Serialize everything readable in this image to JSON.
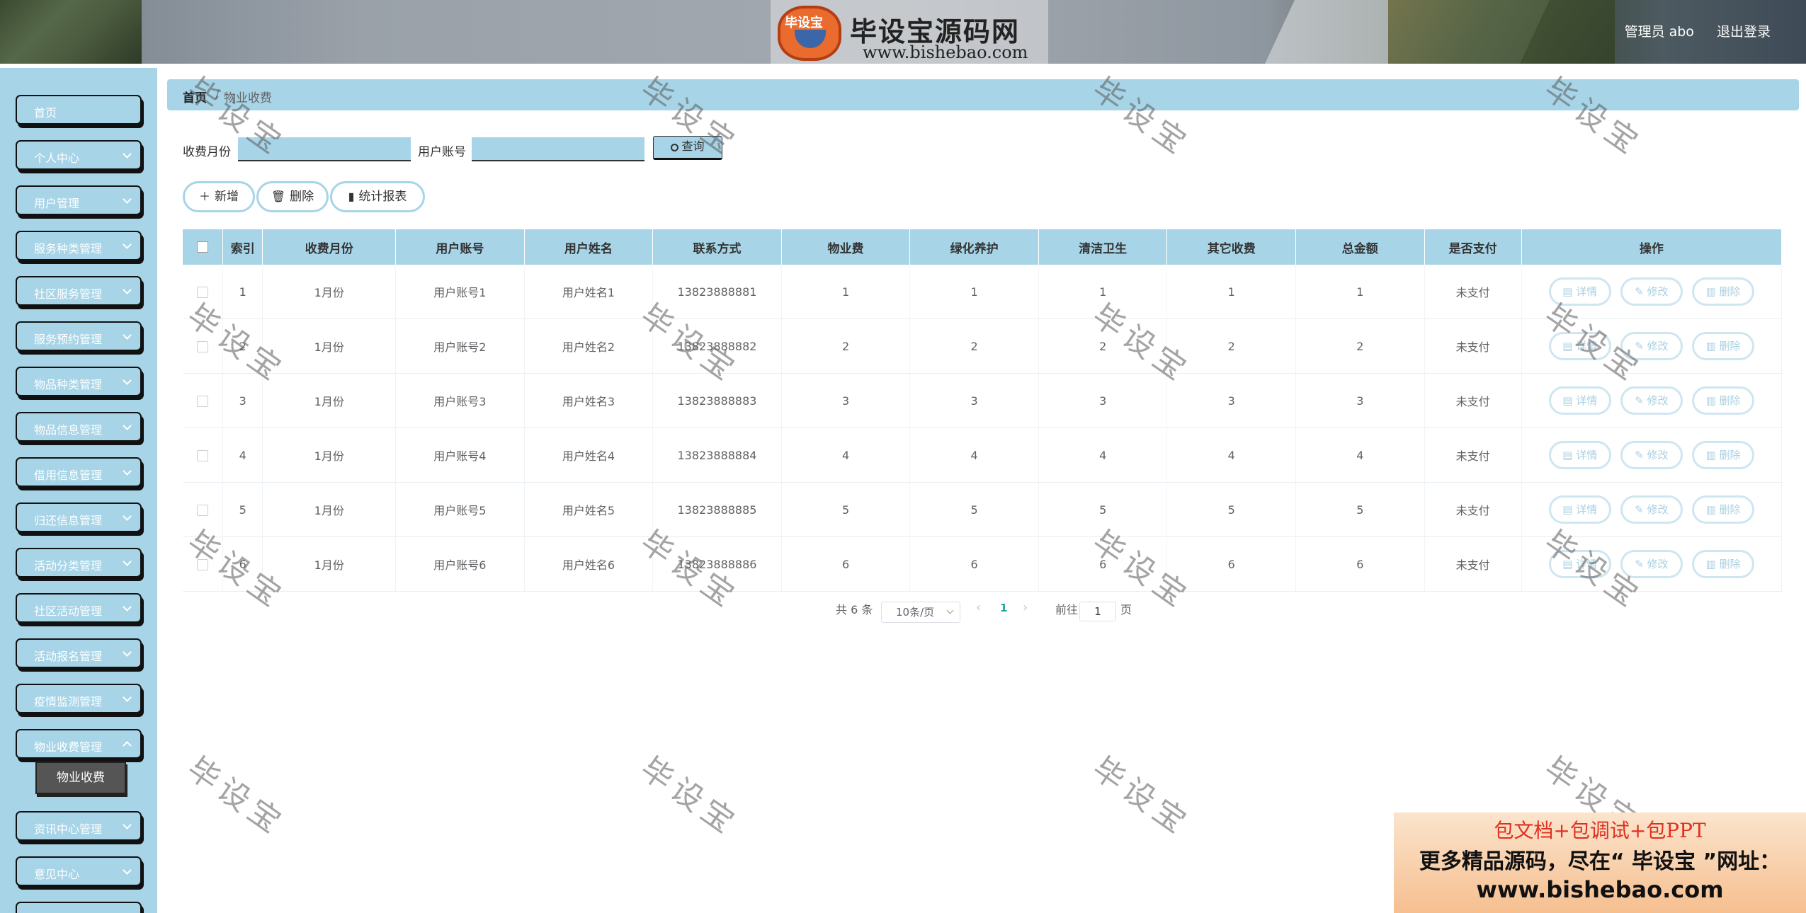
{
  "header": {
    "logo_mark": "毕设宝",
    "logo_title": "毕设宝源码网",
    "logo_url": "www.bishebao.com",
    "user_label": "管理员 abo",
    "logout_label": "退出登录"
  },
  "sidebar": {
    "items": [
      {
        "label": "首页",
        "has_chevron": false
      },
      {
        "label": "个人中心",
        "has_chevron": true
      },
      {
        "label": "用户管理",
        "has_chevron": true
      },
      {
        "label": "服务种类管理",
        "has_chevron": true
      },
      {
        "label": "社区服务管理",
        "has_chevron": true
      },
      {
        "label": "服务预约管理",
        "has_chevron": true
      },
      {
        "label": "物品种类管理",
        "has_chevron": true
      },
      {
        "label": "物品信息管理",
        "has_chevron": true
      },
      {
        "label": "借用信息管理",
        "has_chevron": true
      },
      {
        "label": "归还信息管理",
        "has_chevron": true
      },
      {
        "label": "活动分类管理",
        "has_chevron": true
      },
      {
        "label": "社区活动管理",
        "has_chevron": true
      },
      {
        "label": "活动报名管理",
        "has_chevron": true
      },
      {
        "label": "疫情监测管理",
        "has_chevron": true
      },
      {
        "label": "物业收费管理",
        "has_chevron": true
      },
      {
        "label": "资讯中心管理",
        "has_chevron": true
      },
      {
        "label": "意见中心",
        "has_chevron": true
      }
    ],
    "active_submenu": "物业收费"
  },
  "breadcrumb": {
    "home": "首页",
    "separator": "/",
    "current": "物业收费"
  },
  "search": {
    "month_label": "收费月份",
    "month_placeholder": "",
    "account_label": "用户账号",
    "account_placeholder": "",
    "query_label": "查询"
  },
  "actions": {
    "add_label": "新增",
    "delete_label": "删除",
    "report_label": "统计报表"
  },
  "table": {
    "columns": [
      "索引",
      "收费月份",
      "用户账号",
      "用户姓名",
      "联系方式",
      "物业费",
      "绿化养护",
      "清洁卫生",
      "其它收费",
      "总金额",
      "是否支付",
      "操作"
    ],
    "row_actions": {
      "detail": "详情",
      "edit": "修改",
      "delete": "删除"
    },
    "rows": [
      {
        "index": "1",
        "month": "1月份",
        "account": "用户账号1",
        "name": "用户姓名1",
        "phone": "13823888881",
        "property_fee": "1",
        "greening": "1",
        "cleaning": "1",
        "other": "1",
        "total": "1",
        "paid": "未支付"
      },
      {
        "index": "2",
        "month": "1月份",
        "account": "用户账号2",
        "name": "用户姓名2",
        "phone": "13823888882",
        "property_fee": "2",
        "greening": "2",
        "cleaning": "2",
        "other": "2",
        "total": "2",
        "paid": "未支付"
      },
      {
        "index": "3",
        "month": "1月份",
        "account": "用户账号3",
        "name": "用户姓名3",
        "phone": "13823888883",
        "property_fee": "3",
        "greening": "3",
        "cleaning": "3",
        "other": "3",
        "total": "3",
        "paid": "未支付"
      },
      {
        "index": "4",
        "month": "1月份",
        "account": "用户账号4",
        "name": "用户姓名4",
        "phone": "13823888884",
        "property_fee": "4",
        "greening": "4",
        "cleaning": "4",
        "other": "4",
        "total": "4",
        "paid": "未支付"
      },
      {
        "index": "5",
        "month": "1月份",
        "account": "用户账号5",
        "name": "用户姓名5",
        "phone": "13823888885",
        "property_fee": "5",
        "greening": "5",
        "cleaning": "5",
        "other": "5",
        "total": "5",
        "paid": "未支付"
      },
      {
        "index": "6",
        "month": "1月份",
        "account": "用户账号6",
        "name": "用户姓名6",
        "phone": "13823888886",
        "property_fee": "6",
        "greening": "6",
        "cleaning": "6",
        "other": "6",
        "total": "6",
        "paid": "未支付"
      }
    ]
  },
  "pagination": {
    "total_text": "共 6 条",
    "page_size": "10条/页",
    "current_page": "1",
    "goto_label": "前往",
    "goto_value": "1",
    "page_unit": "页"
  },
  "watermark": "毕设宝",
  "promo": {
    "line1": "包文档+包调试+包PPT",
    "line2": "更多精品源码，尽在“ 毕设宝 ”网址：",
    "line3": "www.bishebao.com"
  },
  "colors": {
    "accent": "#a7d4e7",
    "submenu_active": "#555555",
    "page_active": "#1aa89b",
    "promo_red": "#e03020"
  },
  "icons": {
    "search": "search-icon",
    "add": "plus-icon",
    "delete": "trash-icon",
    "report": "bar-chart-icon",
    "detail": "document-icon",
    "edit": "pencil-icon",
    "expand": "chevron-down-icon"
  }
}
